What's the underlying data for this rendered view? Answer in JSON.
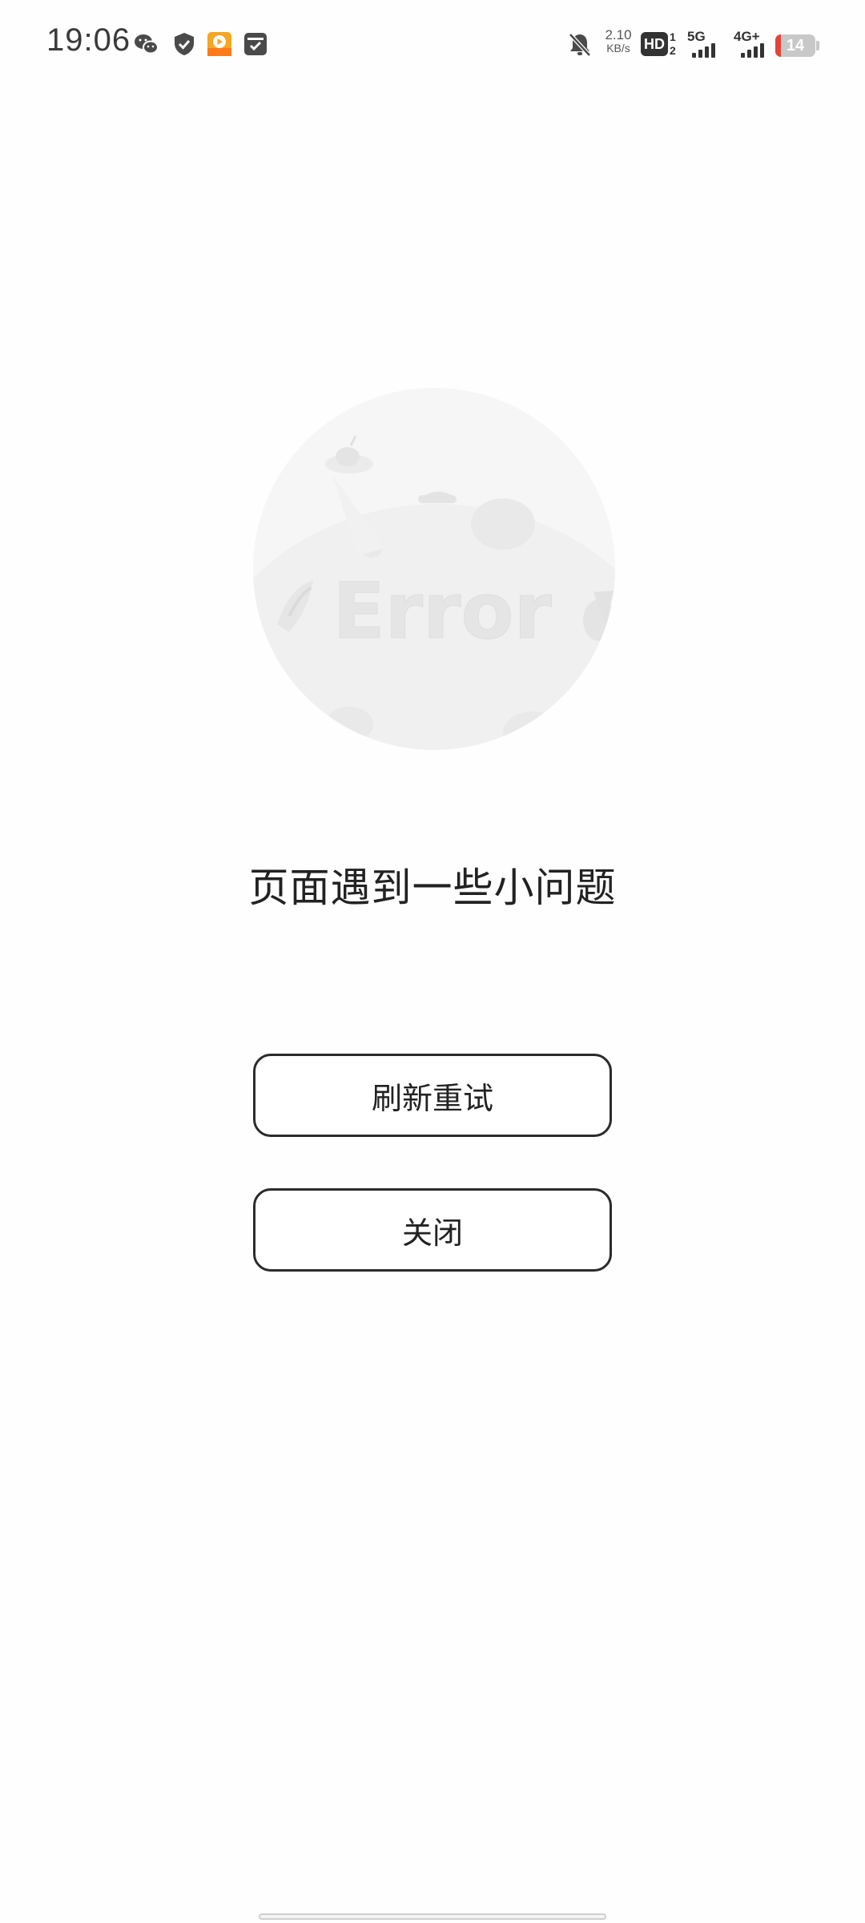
{
  "status_bar": {
    "time": "19:06",
    "left_icons": [
      "wechat-icon",
      "shield-check-icon",
      "video-app-icon",
      "inbox-check-icon"
    ],
    "mute_icon": "bell-off-icon",
    "net_speed_value": "2.10",
    "net_speed_unit": "KB/s",
    "hd_label": "HD",
    "hd_sub_top": "1",
    "hd_sub_bottom": "2",
    "network1": "5G",
    "network2": "4G+",
    "battery": "14",
    "battery_level": 0.14
  },
  "illustration": {
    "label": "Error"
  },
  "main": {
    "message": "页面遇到一些小问题",
    "refresh_button": "刷新重试",
    "close_button": "关闭"
  },
  "colors": {
    "text": "#222222",
    "button_border": "#2b2b2b",
    "battery_low": "#e5433a",
    "illustration_bg": "#f6f6f7"
  }
}
